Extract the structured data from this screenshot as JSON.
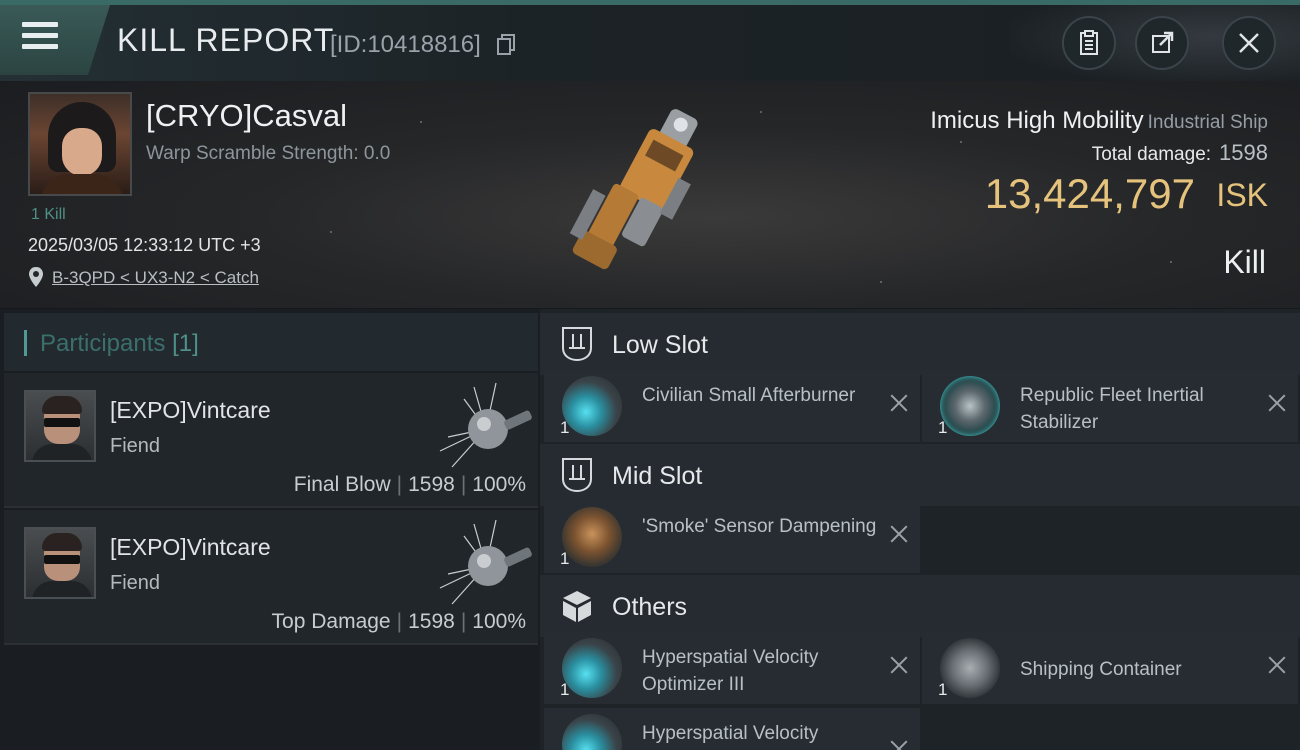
{
  "header": {
    "title": "KILL REPORT",
    "report_id": "[ID:10418816]"
  },
  "victim": {
    "name": "[CRYO]Casval",
    "warp_scramble": "Warp Scramble Strength: 0.0",
    "kills": "1 Kill",
    "datetime": "2025/03/05 12:33:12 UTC +3",
    "location": "B-3QPD < UX3-N2 < Catch"
  },
  "ship": {
    "name": "Imicus High Mobility",
    "class": "Industrial Ship",
    "total_damage_label": "Total damage:",
    "total_damage": "1598",
    "value": "13,424,797",
    "currency": "ISK",
    "result": "Kill"
  },
  "participants": {
    "label": "Participants",
    "count": "[1]",
    "rows": [
      {
        "name": "[EXPO]Vintcare",
        "ship": "Fiend",
        "role": "Final Blow",
        "damage": "1598",
        "percent": "100%"
      },
      {
        "name": "[EXPO]Vintcare",
        "ship": "Fiend",
        "role": "Top Damage",
        "damage": "1598",
        "percent": "100%"
      }
    ]
  },
  "fitting": {
    "low_slot": {
      "title": "Low Slot",
      "items": [
        {
          "name": "Civilian Small Afterburner",
          "qty": "1",
          "icon": "afterburner-icon"
        },
        {
          "name": "Republic Fleet Inertial Stabilizer",
          "qty": "1",
          "icon": "stabilizer-icon"
        }
      ]
    },
    "mid_slot": {
      "title": "Mid Slot",
      "items": [
        {
          "name": "'Smoke' Sensor Dampening",
          "qty": "1",
          "icon": "sensor-dampener-icon"
        }
      ]
    },
    "others": {
      "title": "Others",
      "items": [
        {
          "name": "Hyperspatial Velocity Optimizer III",
          "qty": "1",
          "icon": "velocity-optimizer-icon"
        },
        {
          "name": "Shipping Container",
          "qty": "1",
          "icon": "container-icon"
        },
        {
          "name": "Hyperspatial Velocity",
          "qty": "",
          "icon": "velocity-optimizer-icon"
        }
      ]
    }
  },
  "colors": {
    "accent": "#4f9a93",
    "isk": "#e6c37c",
    "panel": "#20262a"
  }
}
